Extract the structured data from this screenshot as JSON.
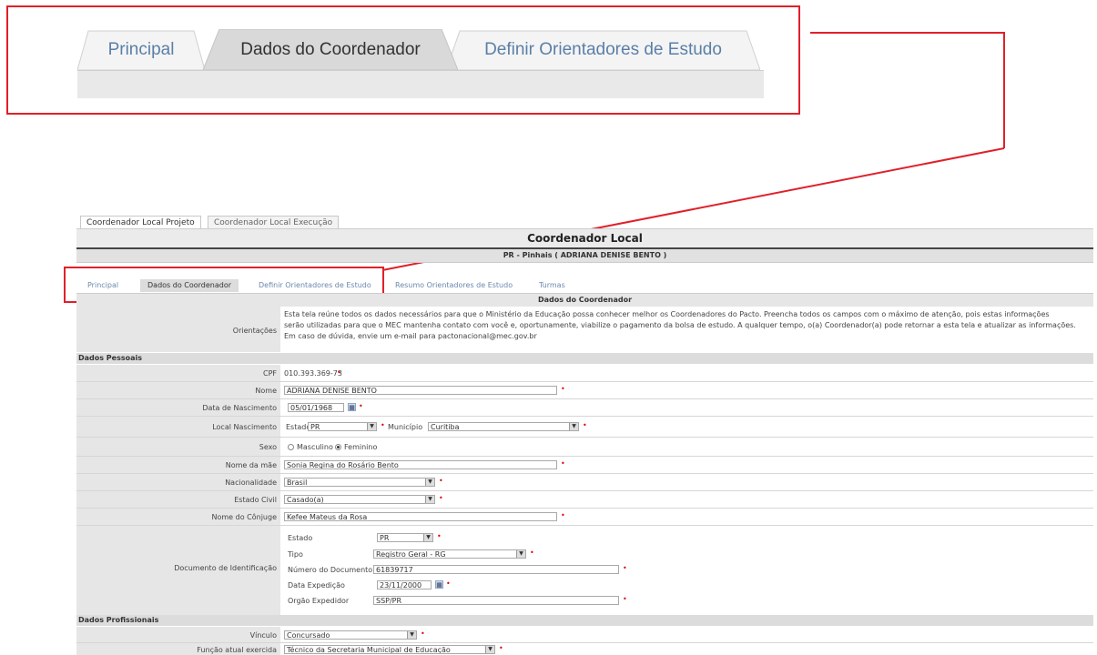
{
  "zoom": {
    "tabs": [
      {
        "label": "Principal"
      },
      {
        "label": "Dados do Coordenador"
      },
      {
        "label": "Definir Orientadores de Estudo"
      }
    ]
  },
  "top_tabs": [
    "Coordenador Local Projeto",
    "Coordenador Local Execução"
  ],
  "page_title": "Coordenador Local",
  "page_subtitle": "PR - Pinhais ( ADRIANA DENISE BENTO )",
  "inner_tabs": [
    "Principal",
    "Dados do Coordenador",
    "Definir Orientadores de Estudo",
    "Resumo Orientadores de Estudo",
    "Turmas"
  ],
  "section_title": "Dados do Coordenador",
  "orientacoes": {
    "label": "Orientações",
    "line1": "Esta tela reúne todos os dados necessários para que o Ministério da Educação possa conhecer melhor os Coordenadores do Pacto. Preencha todos os campos com o máximo de atenção, pois estas informações",
    "line2": "serão utilizadas para que o MEC mantenha contato com você e, oportunamente, viabilize o pagamento da bolsa de estudo. A qualquer tempo, o(a) Coordenador(a) pode retornar a esta tela e atualizar as informações.",
    "line3": "Em caso de dúvida, envie um e-mail para pactonacional@mec.gov.br"
  },
  "dados_pessoais": {
    "group_label": "Dados Pessoais",
    "cpf": {
      "label": "CPF",
      "value": "010.393.369-73"
    },
    "nome": {
      "label": "Nome",
      "value": "ADRIANA DENISE BENTO"
    },
    "nascimento": {
      "label": "Data de Nascimento",
      "value": "05/01/1968"
    },
    "local_nasc": {
      "label": "Local Nascimento",
      "estado_label": "Estado",
      "estado": "PR",
      "municipio_label": "Município",
      "municipio": "Curitiba"
    },
    "sexo": {
      "label": "Sexo",
      "opt1": "Masculino",
      "opt2": "Feminino"
    },
    "mae": {
      "label": "Nome da mãe",
      "value": "Sonia Regina do Rosário Bento"
    },
    "nacionalidade": {
      "label": "Nacionalidade",
      "value": "Brasil"
    },
    "estado_civil": {
      "label": "Estado Civil",
      "value": "Casado(a)"
    },
    "conjuge": {
      "label": "Nome do Cônjuge",
      "value": "Kefee Mateus da Rosa"
    },
    "doc": {
      "label": "Documento de Identificação",
      "estado_label": "Estado",
      "estado": "PR",
      "tipo_label": "Tipo",
      "tipo": "Registro Geral - RG",
      "numero_label": "Número do Documento",
      "numero": "61839717",
      "expedicao_label": "Data Expedição",
      "expedicao": "23/11/2000",
      "orgao_label": "Orgão Expedidor",
      "orgao": "SSP/PR"
    }
  },
  "dados_profissionais": {
    "group_label": "Dados Profissionais",
    "vinculo": {
      "label": "Vínculo",
      "value": "Concursado"
    },
    "funcao": {
      "label": "Função atual exercida",
      "value": "Técnico da Secretaria Municipal de Educação"
    }
  },
  "colors": {
    "callout": "#e0202a",
    "tab_link": "#5a7fa8"
  }
}
